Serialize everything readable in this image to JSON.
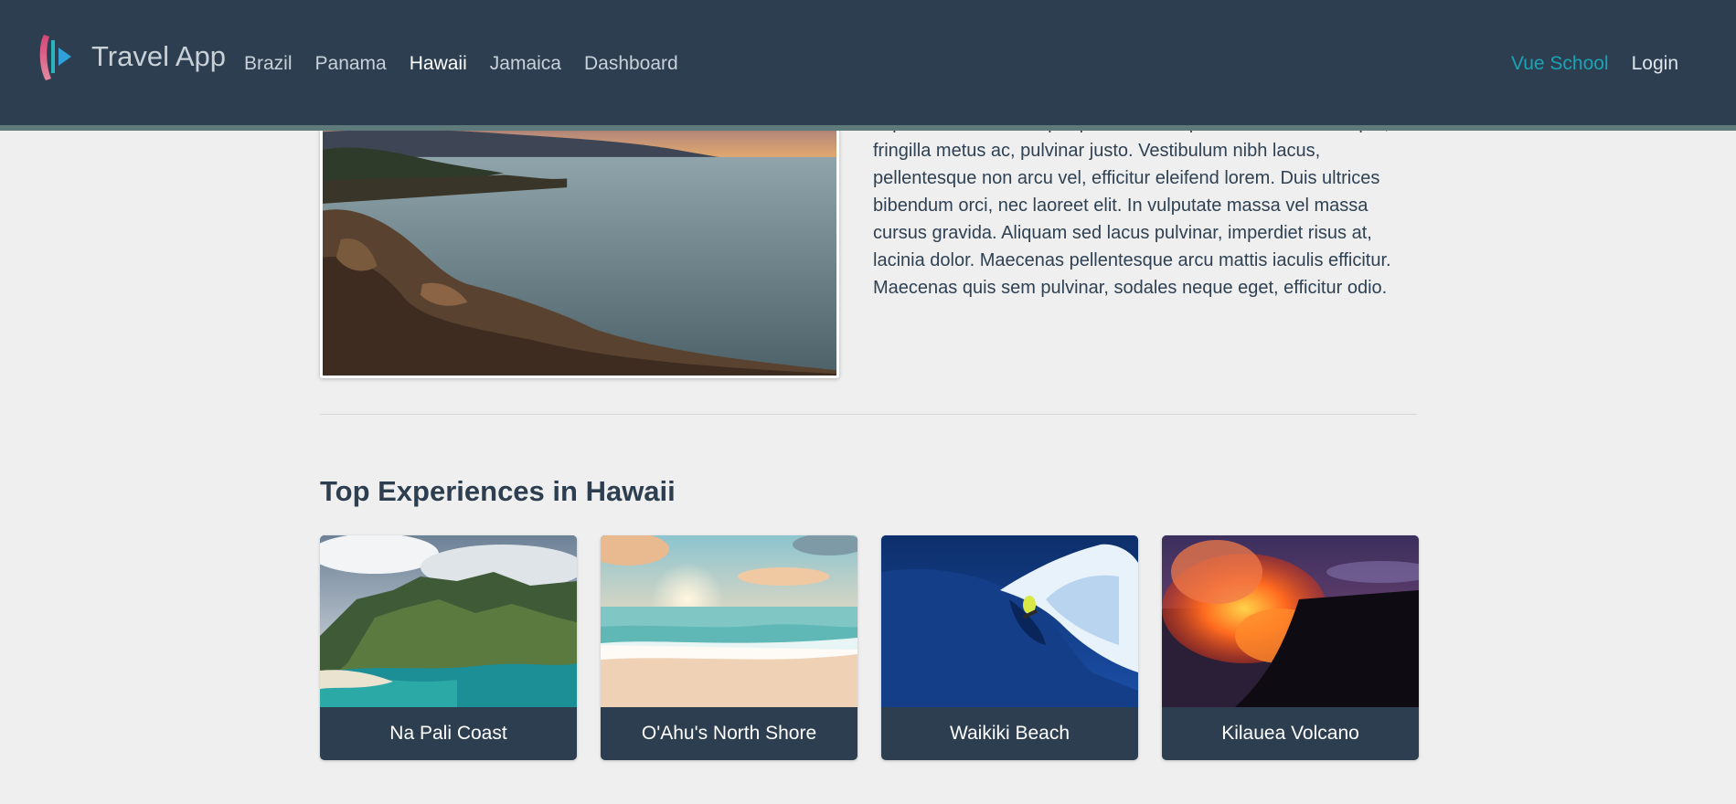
{
  "navbar": {
    "brand": "Travel App",
    "links": [
      {
        "label": "Brazil",
        "active": false
      },
      {
        "label": "Panama",
        "active": false
      },
      {
        "label": "Hawaii",
        "active": true
      },
      {
        "label": "Jamaica",
        "active": false
      },
      {
        "label": "Dashboard",
        "active": false
      }
    ],
    "vue_school": "Vue School",
    "login": "Login",
    "colors": {
      "background": "#2c3e50",
      "accent": "#1ba3b5"
    }
  },
  "destination": {
    "description": "Lorem ipsum dolor sit amet, consectetur adipiscing elit. Fusce imperdiet orci eu semper pharetra. Suspendisse vel elit semper, fringilla metus ac, pulvinar justo. Vestibulum nibh lacus, pellentesque non arcu vel, efficitur eleifend lorem. Duis ultrices bibendum orci, nec laoreet elit. In vulputate massa vel massa cursus gravida. Aliquam sed lacus pulvinar, imperdiet risus at, lacinia dolor. Maecenas pellentesque arcu mattis iaculis efficitur. Maecenas quis sem pulvinar, sodales neque eget, efficitur odio."
  },
  "experiences": {
    "title": "Top Experiences in Hawaii",
    "items": [
      {
        "name": "Na Pali Coast"
      },
      {
        "name": "O'Ahu's North Shore"
      },
      {
        "name": "Waikiki Beach"
      },
      {
        "name": "Kilauea Volcano"
      }
    ]
  }
}
